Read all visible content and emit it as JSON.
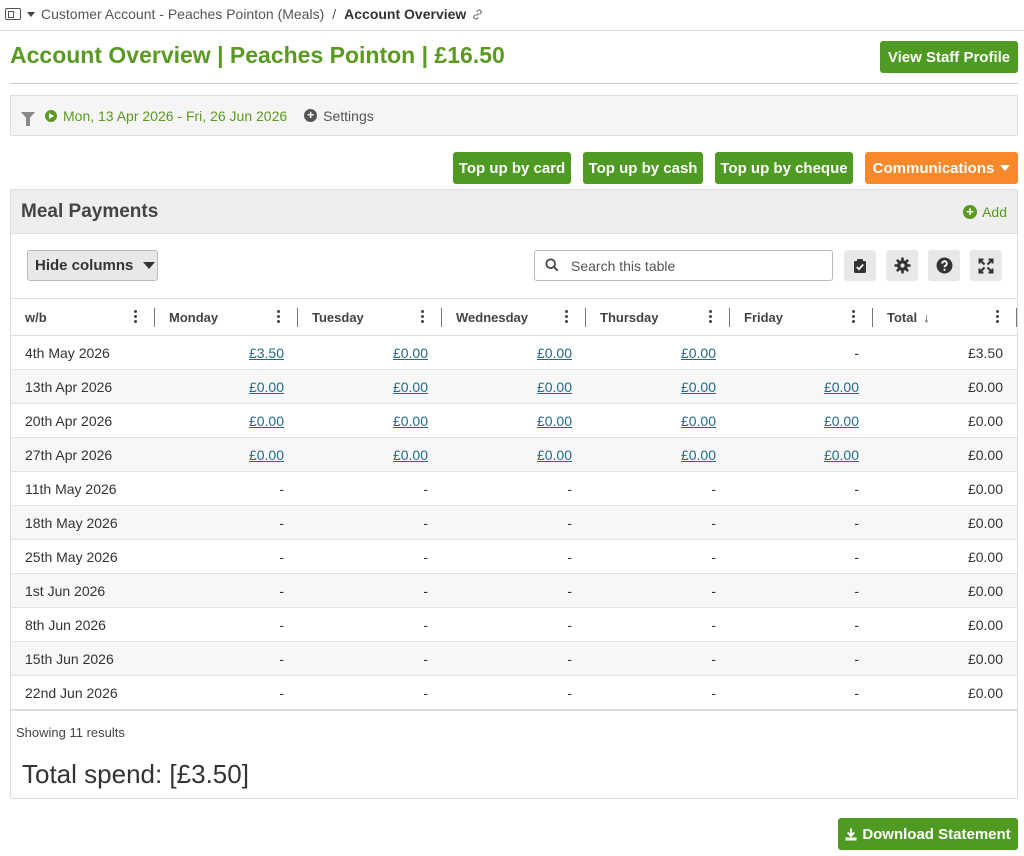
{
  "breadcrumb": {
    "parent": "Customer Account - Peaches Pointon (Meals)",
    "separator": "/",
    "current": "Account Overview"
  },
  "header": {
    "title": "Account Overview | Peaches Pointon | £16.50",
    "view_staff_label": "View Staff Profile"
  },
  "filter": {
    "date_range": "Mon, 13 Apr 2026 - Fri, 26 Jun 2026",
    "settings_label": "Settings"
  },
  "actions": {
    "top_up_card": "Top up by card",
    "top_up_cash": "Top up by cash",
    "top_up_cheque": "Top up by cheque",
    "communications": "Communications"
  },
  "panel": {
    "title": "Meal Payments",
    "add_label": "Add",
    "hide_columns_label": "Hide columns",
    "search_placeholder": "Search this table"
  },
  "table": {
    "columns": [
      "w/b",
      "Monday",
      "Tuesday",
      "Wednesday",
      "Thursday",
      "Friday",
      "Total"
    ],
    "sort_indicator": "↓",
    "rows": [
      [
        "4th May 2026",
        "£3.50",
        "£0.00",
        "£0.00",
        "£0.00",
        "-",
        "£3.50"
      ],
      [
        "13th Apr 2026",
        "£0.00",
        "£0.00",
        "£0.00",
        "£0.00",
        "£0.00",
        "£0.00"
      ],
      [
        "20th Apr 2026",
        "£0.00",
        "£0.00",
        "£0.00",
        "£0.00",
        "£0.00",
        "£0.00"
      ],
      [
        "27th Apr 2026",
        "£0.00",
        "£0.00",
        "£0.00",
        "£0.00",
        "£0.00",
        "£0.00"
      ],
      [
        "11th May 2026",
        "-",
        "-",
        "-",
        "-",
        "-",
        "£0.00"
      ],
      [
        "18th May 2026",
        "-",
        "-",
        "-",
        "-",
        "-",
        "£0.00"
      ],
      [
        "25th May 2026",
        "-",
        "-",
        "-",
        "-",
        "-",
        "£0.00"
      ],
      [
        "1st Jun 2026",
        "-",
        "-",
        "-",
        "-",
        "-",
        "£0.00"
      ],
      [
        "8th Jun 2026",
        "-",
        "-",
        "-",
        "-",
        "-",
        "£0.00"
      ],
      [
        "15th Jun 2026",
        "-",
        "-",
        "-",
        "-",
        "-",
        "£0.00"
      ],
      [
        "22nd Jun 2026",
        "-",
        "-",
        "-",
        "-",
        "-",
        "£0.00"
      ]
    ]
  },
  "footer": {
    "showing": "Showing 11 results",
    "total_spend": "Total spend: [£3.50]",
    "download_label": "Download Statement"
  },
  "colors": {
    "brand_green": "#4e9a22",
    "title_green": "#5a9a22",
    "orange": "#f7892b",
    "link_blue": "#1f6b8c"
  },
  "icons": {
    "sidebar_toggle": "sidebar-toggle-icon",
    "link": "link-icon",
    "filter": "filter-icon",
    "play": "play-circle-icon",
    "settings": "plus-circle-icon",
    "add": "plus-circle-icon",
    "search": "search-icon",
    "check": "clipboard-check-icon",
    "gear": "gear-icon",
    "help": "question-icon",
    "expand": "expand-icon",
    "download": "download-icon"
  }
}
